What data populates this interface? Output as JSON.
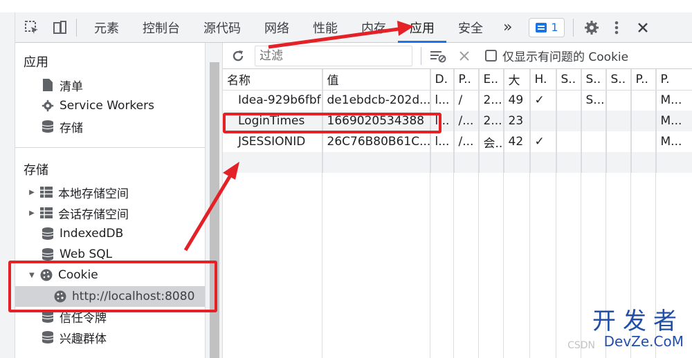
{
  "toolbar": {
    "tabs": [
      "元素",
      "控制台",
      "源代码",
      "网络",
      "性能",
      "内存",
      "应用",
      "安全"
    ],
    "overflow": "»",
    "message_count": "1"
  },
  "sidebar": {
    "app_header": "应用",
    "app_items": [
      "清单",
      "Service Workers",
      "存储"
    ],
    "storage_header": "存储",
    "storage_items": [
      "本地存储空间",
      "会话存储空间",
      "IndexedDB",
      "Web SQL",
      "Cookie"
    ],
    "cookie_origin": "http://localhost:8080",
    "more_items": [
      "信任令牌",
      "兴趣群体"
    ]
  },
  "filter": {
    "placeholder": "过滤",
    "only_issues_label": "仅显示有问题的 Cookie"
  },
  "table": {
    "headers": [
      "名称",
      "值",
      "D.",
      "P..",
      "E..",
      "大",
      "H.",
      "S..",
      "S..",
      "S..",
      "P..",
      "P."
    ],
    "rows": [
      [
        "Idea-929b6fbf",
        "de1ebdcb-202d...",
        "l...",
        "/",
        "2...",
        "49",
        "✓",
        "",
        "S...",
        "",
        "",
        "M..."
      ],
      [
        "LoginTimes",
        "1669020534388",
        "l...",
        "/...",
        "2...",
        "23",
        "",
        "",
        "",
        "",
        "",
        "M..."
      ],
      [
        "JSESSIONID",
        "26C76B80B61C...",
        "l...",
        "/...",
        "会...",
        "42",
        "✓",
        "",
        "",
        "",
        "",
        "M..."
      ]
    ]
  },
  "watermark": {
    "line1": "开发者",
    "line2": "DevZe.CoM",
    "faint": "CSDN"
  },
  "colors": {
    "accent": "#1a73e8",
    "annotation": "#e32127",
    "watermark": "#1f4fa8"
  }
}
